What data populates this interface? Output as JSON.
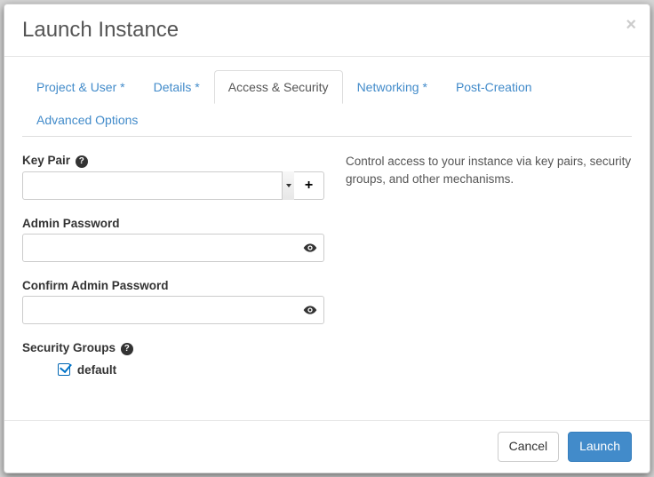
{
  "title": "Launch Instance",
  "tabs": [
    {
      "label": "Project & User *",
      "active": false
    },
    {
      "label": "Details *",
      "active": false
    },
    {
      "label": "Access & Security",
      "active": true
    },
    {
      "label": "Networking *",
      "active": false
    },
    {
      "label": "Post-Creation",
      "active": false
    },
    {
      "label": "Advanced Options",
      "active": false
    }
  ],
  "form": {
    "key_pair_label": "Key Pair",
    "key_pair_value": "",
    "admin_password_label": "Admin Password",
    "admin_password_value": "",
    "confirm_admin_password_label": "Confirm Admin Password",
    "confirm_admin_password_value": "",
    "security_groups_label": "Security Groups",
    "security_groups": [
      {
        "name": "default",
        "checked": true
      }
    ],
    "add_icon": "+"
  },
  "description": "Control access to your instance via key pairs, security groups, and other mechanisms.",
  "buttons": {
    "cancel": "Cancel",
    "launch": "Launch"
  },
  "close_glyph": "×",
  "help_glyph": "?"
}
